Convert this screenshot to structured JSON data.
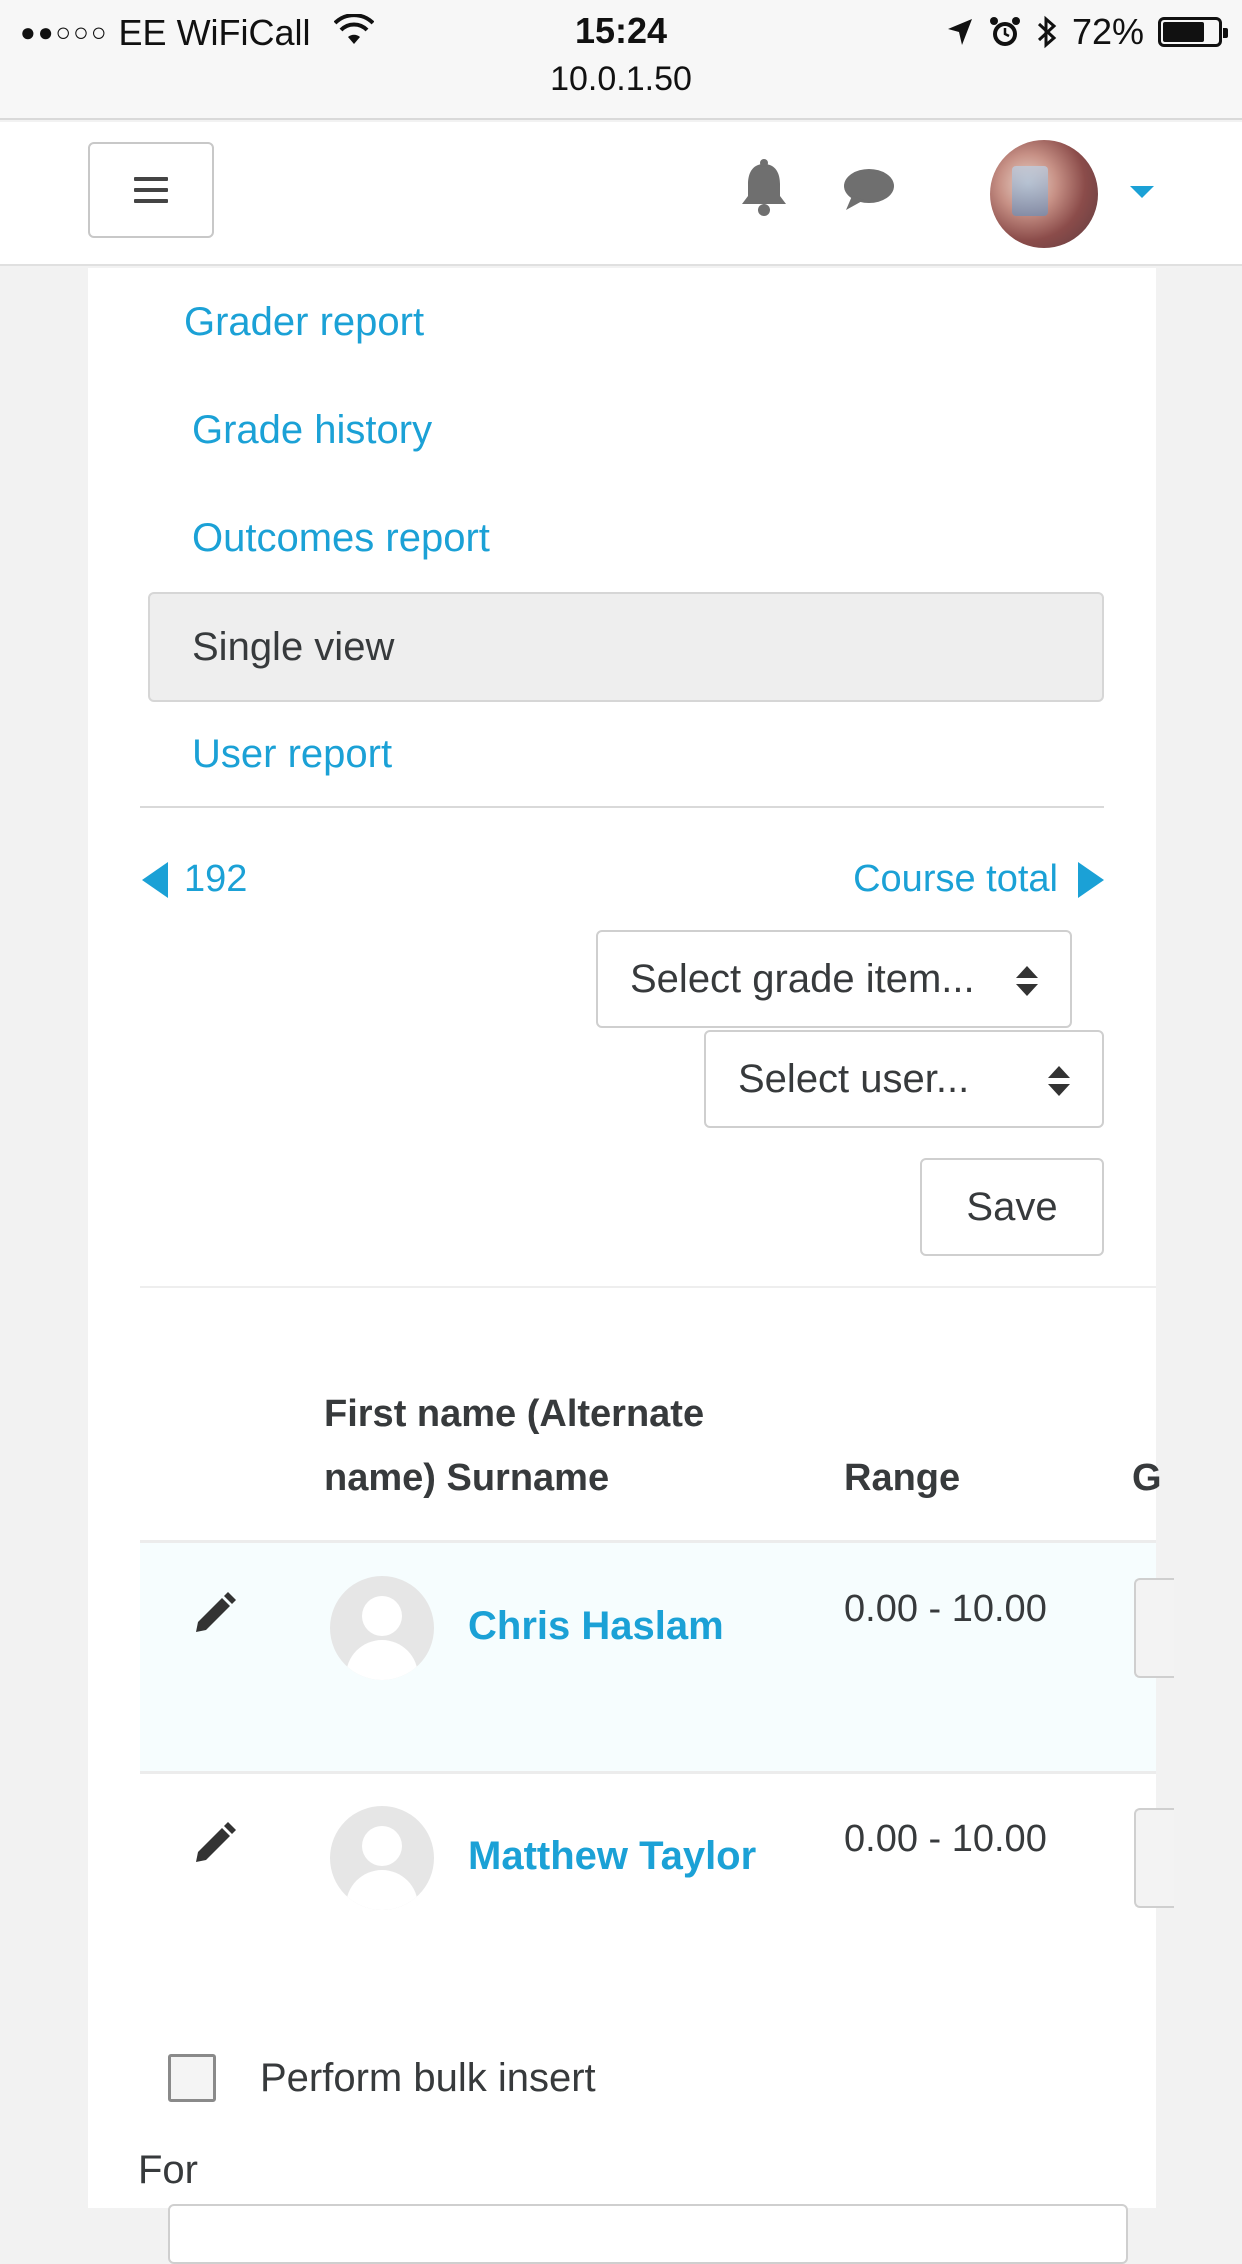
{
  "status_bar": {
    "carrier_dots": "●●○○○",
    "carrier": "EE WiFiCall",
    "time": "15:24",
    "url": "10.0.1.50",
    "battery": "72%"
  },
  "navbar": {
    "icons": [
      "hamburger-icon",
      "bell-icon",
      "chat-icon",
      "avatar",
      "caret-down-icon"
    ]
  },
  "report_nav": {
    "items": [
      {
        "label": "Grader report"
      },
      {
        "label": "Grade history"
      },
      {
        "label": "Outcomes report"
      },
      {
        "label": "Single view",
        "active": true
      },
      {
        "label": "User report"
      }
    ]
  },
  "pager": {
    "prev_label": "192",
    "next_label": "Course total"
  },
  "filters": {
    "grade_item": "Select grade item...",
    "user": "Select user..."
  },
  "actions": {
    "save_label": "Save"
  },
  "table": {
    "headers": {
      "name_line1": "First name (Alternate",
      "name_line2": "name) Surname",
      "range": "Range",
      "grade_partial": "G"
    },
    "rows": [
      {
        "name": "Chris Haslam",
        "range": "0.00 - 10.00"
      },
      {
        "name": "Matthew Taylor",
        "range": "0.00 - 10.00"
      }
    ]
  },
  "bulk": {
    "checkbox_label": "Perform bulk insert",
    "for_label": "For"
  },
  "colors": {
    "link": "#1ba1d6",
    "text": "#373a3c",
    "active_bg": "#eeeeee",
    "page_bg": "#f2f2f2"
  }
}
